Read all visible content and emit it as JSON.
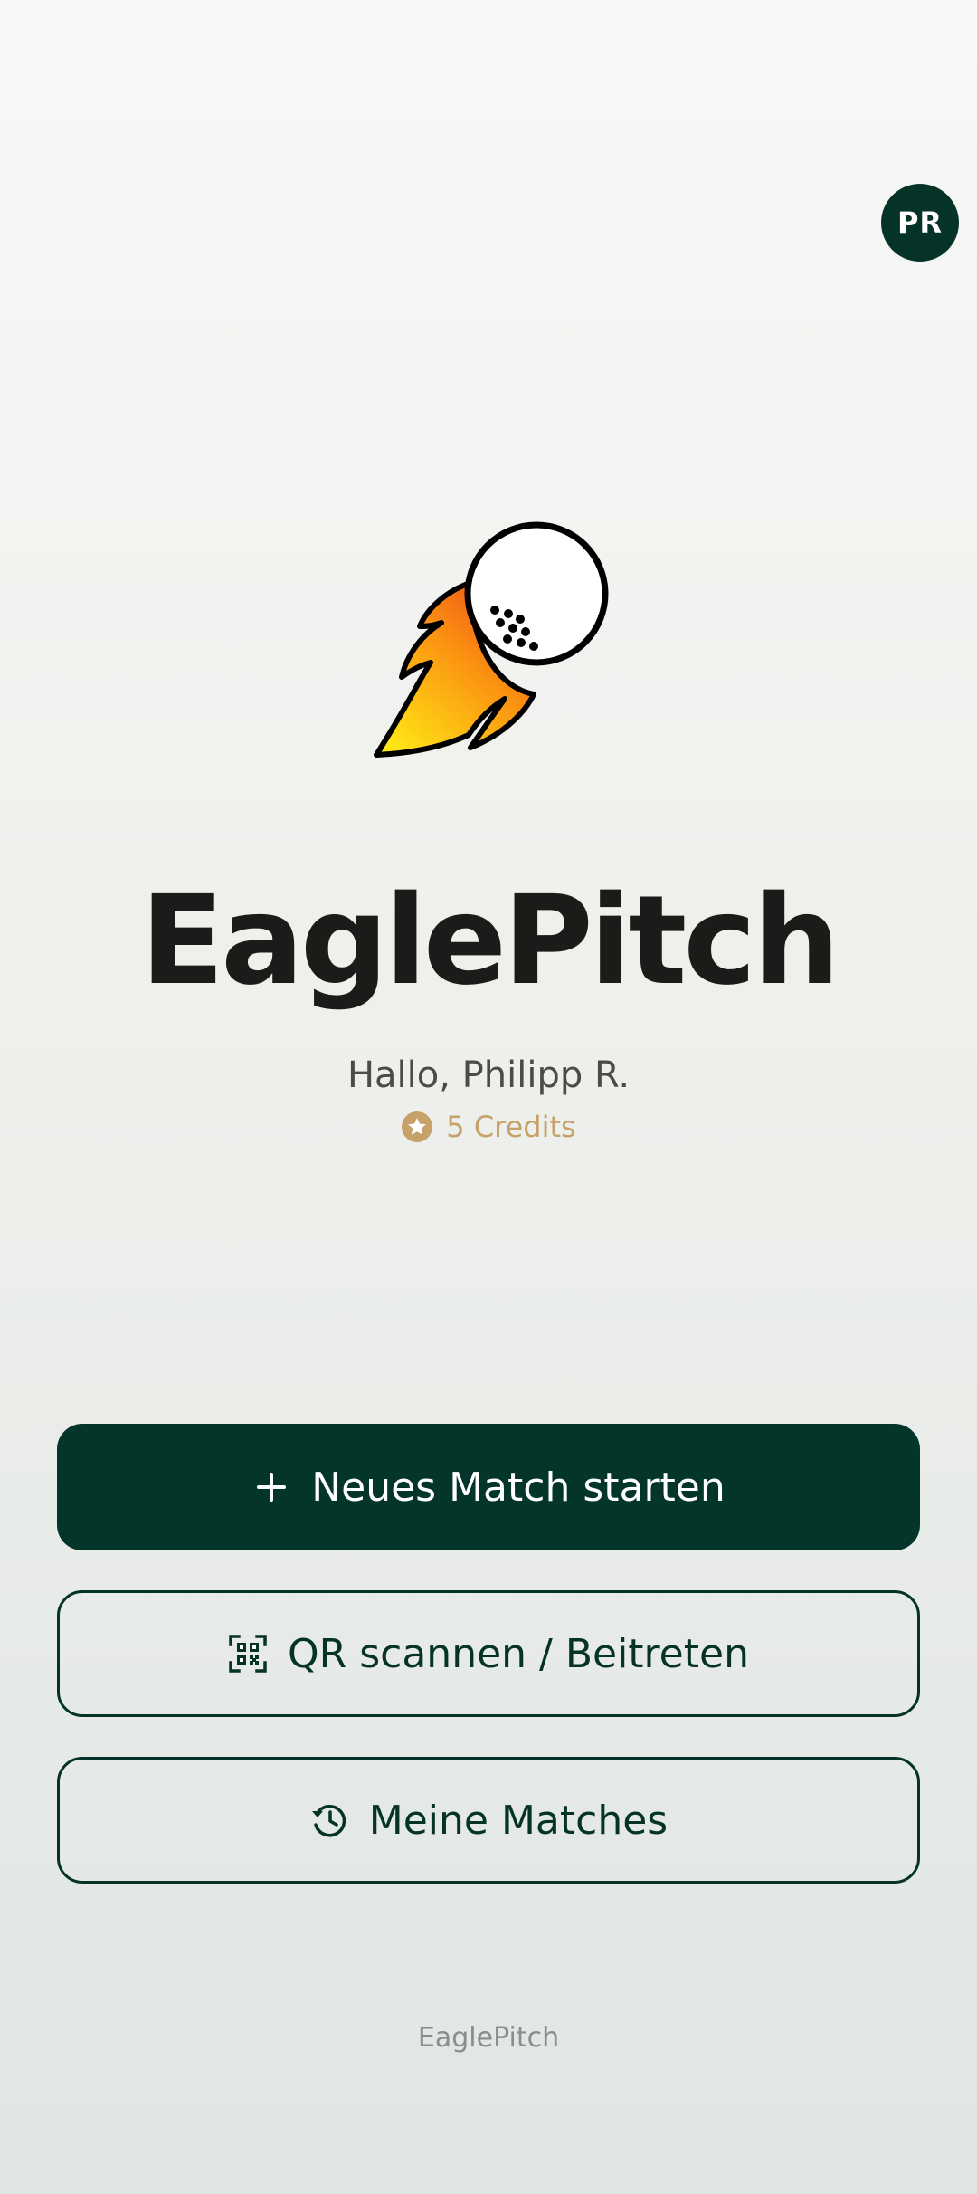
{
  "header": {
    "avatar_initials": "PR"
  },
  "hero": {
    "app_name": "EaglePitch",
    "greeting": "Hallo, Philipp R.",
    "credits": "5 Credits",
    "logo_icon": "flaming-golf-ball-icon"
  },
  "actions": {
    "new_match": {
      "label": "Neues Match starten",
      "icon": "plus-icon"
    },
    "scan_qr": {
      "label": "QR scannen / Beitreten",
      "icon": "qr-code-icon"
    },
    "my_matches": {
      "label": "Meine Matches",
      "icon": "history-icon"
    }
  },
  "footer": {
    "brand": "EaglePitch"
  },
  "colors": {
    "primary": "#03352a",
    "credits_gold": "#c6a26a",
    "title_text": "#1b1c19",
    "background_top": "#f8f8f6",
    "background_bottom": "#e1e6e2"
  }
}
